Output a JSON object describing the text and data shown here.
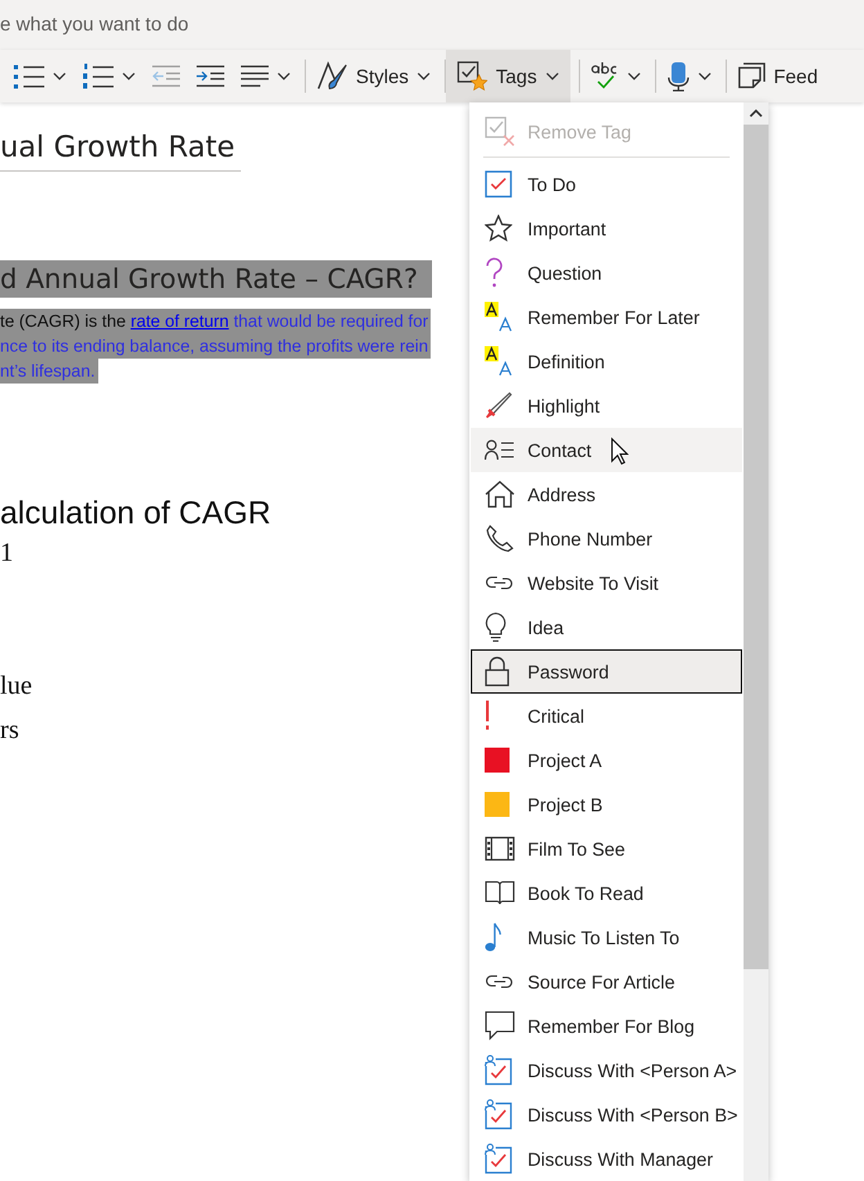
{
  "search": {
    "placeholder": "e what you want to do"
  },
  "toolbar": [
    {
      "kind": "bullets",
      "dropdown": true,
      "disabled": false,
      "pressed": false
    },
    {
      "kind": "numbering",
      "dropdown": true,
      "disabled": false,
      "pressed": false
    },
    {
      "kind": "outdent",
      "dropdown": false,
      "disabled": true,
      "pressed": false
    },
    {
      "kind": "indent",
      "dropdown": false,
      "disabled": false,
      "pressed": false
    },
    {
      "kind": "align",
      "dropdown": true,
      "disabled": false,
      "pressed": false
    },
    {
      "kind": "separator"
    },
    {
      "kind": "styles",
      "label": "Styles",
      "dropdown": true,
      "disabled": false,
      "pressed": false
    },
    {
      "kind": "separator"
    },
    {
      "kind": "tags",
      "label": "Tags",
      "dropdown": true,
      "disabled": false,
      "pressed": true
    },
    {
      "kind": "separator"
    },
    {
      "kind": "spelling",
      "dropdown": true,
      "disabled": false,
      "pressed": false
    },
    {
      "kind": "separator"
    },
    {
      "kind": "dictate",
      "dropdown": true,
      "disabled": false,
      "pressed": false
    },
    {
      "kind": "separator"
    },
    {
      "kind": "feed",
      "label": "Feed",
      "dropdown": false,
      "disabled": false,
      "pressed": false
    }
  ],
  "document": {
    "title": "ual Growth Rate",
    "heading": "d Annual Growth Rate – CAGR?",
    "paragraph_lines": [
      {
        "lead": "te (CAGR) is the ",
        "link": "rate of return",
        "rest": " that would be required for"
      },
      {
        "rest": "nce to its ending balance, assuming the profits were rein"
      },
      {
        "rest": "nt’s lifespan."
      }
    ],
    "subheading": "alculation of CAGR",
    "body_lines": [
      "1",
      "lue",
      "rs"
    ]
  },
  "tags_menu": [
    {
      "kind": "remove-tag",
      "label": "Remove Tag",
      "disabled": true,
      "hovered": false,
      "focused": false
    },
    {
      "kind": "todo",
      "label": "To Do",
      "disabled": false,
      "hovered": false,
      "focused": false
    },
    {
      "kind": "star",
      "label": "Important",
      "disabled": false,
      "hovered": false,
      "focused": false
    },
    {
      "kind": "question",
      "label": "Question",
      "disabled": false,
      "hovered": false,
      "focused": false
    },
    {
      "kind": "letters",
      "label": "Remember For Later",
      "disabled": false,
      "hovered": false,
      "focused": false
    },
    {
      "kind": "letters",
      "label": "Definition",
      "disabled": false,
      "hovered": false,
      "focused": false
    },
    {
      "kind": "highlighter",
      "label": "Highlight",
      "disabled": false,
      "hovered": false,
      "focused": false
    },
    {
      "kind": "contact",
      "label": "Contact",
      "disabled": false,
      "hovered": true,
      "focused": false
    },
    {
      "kind": "house",
      "label": "Address",
      "disabled": false,
      "hovered": false,
      "focused": false
    },
    {
      "kind": "phone",
      "label": "Phone Number",
      "disabled": false,
      "hovered": false,
      "focused": false
    },
    {
      "kind": "link",
      "label": "Website To Visit",
      "disabled": false,
      "hovered": false,
      "focused": false
    },
    {
      "kind": "bulb",
      "label": "Idea",
      "disabled": false,
      "hovered": false,
      "focused": false
    },
    {
      "kind": "lock",
      "label": "Password",
      "disabled": false,
      "hovered": false,
      "focused": true
    },
    {
      "kind": "exclamation",
      "label": "Critical",
      "disabled": false,
      "hovered": false,
      "focused": false
    },
    {
      "kind": "square",
      "label": "Project A",
      "color": "#e81123",
      "disabled": false,
      "hovered": false,
      "focused": false
    },
    {
      "kind": "square",
      "label": "Project B",
      "color": "#fcb714",
      "disabled": false,
      "hovered": false,
      "focused": false
    },
    {
      "kind": "film",
      "label": "Film To See",
      "disabled": false,
      "hovered": false,
      "focused": false
    },
    {
      "kind": "book",
      "label": "Book To Read",
      "disabled": false,
      "hovered": false,
      "focused": false
    },
    {
      "kind": "note",
      "label": "Music To Listen To",
      "disabled": false,
      "hovered": false,
      "focused": false
    },
    {
      "kind": "link",
      "label": "Source For Article",
      "disabled": false,
      "hovered": false,
      "focused": false
    },
    {
      "kind": "speech",
      "label": "Remember For Blog",
      "disabled": false,
      "hovered": false,
      "focused": false
    },
    {
      "kind": "person-check",
      "label": "Discuss With <Person A>",
      "disabled": false,
      "hovered": false,
      "focused": false
    },
    {
      "kind": "person-check",
      "label": "Discuss With <Person B>",
      "disabled": false,
      "hovered": false,
      "focused": false
    },
    {
      "kind": "person-check",
      "label": "Discuss With Manager",
      "disabled": false,
      "hovered": false,
      "focused": false
    }
  ]
}
